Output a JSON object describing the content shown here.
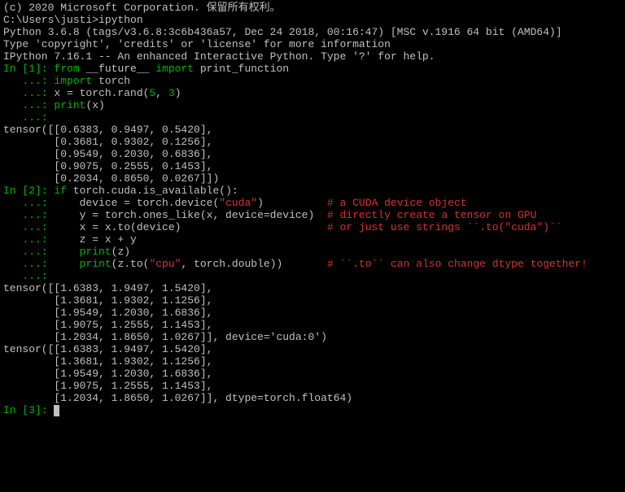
{
  "header": {
    "copyright": "(c) 2020 Microsoft Corporation. 保留所有权利。",
    "blank1": "",
    "prompt_cmd": "C:\\Users\\justi>ipython",
    "py_ver": "Python 3.6.8 (tags/v3.6.8:3c6b436a57, Dec 24 2018, 00:16:47) [MSC v.1916 64 bit (AMD64)]",
    "type_info": "Type 'copyright', 'credits' or 'license' for more information",
    "ipy_ver": "IPython 7.16.1 -- An enhanced Interactive Python. Type '?' for help.",
    "blank2": ""
  },
  "in1": {
    "p0": "In [1]: ",
    "p1": "   ...: ",
    "kw_from": "from",
    "mod_future": " __future__ ",
    "kw_import1": "import",
    "txt_print_function": " print_function",
    "kw_import2": "import",
    "mod_torch": " torch",
    "assign_x": "x = torch.rand(",
    "num5": "5",
    "comma1": ", ",
    "num3": "3",
    "paren_close": ")",
    "print_call": "print",
    "print_arg": "(x)"
  },
  "out1": {
    "l0": "tensor([[0.6383, 0.9497, 0.5420],",
    "l1": "        [0.3681, 0.9302, 0.1256],",
    "l2": "        [0.9549, 0.2030, 0.6836],",
    "l3": "        [0.9075, 0.2555, 0.1453],",
    "l4": "        [0.2034, 0.8650, 0.0267]])",
    "blank": ""
  },
  "in2": {
    "p0": "In [2]: ",
    "p1": "   ...: ",
    "kw_if": "if",
    "cond": " torch.cuda.is_available():",
    "dev_pre": "    device = torch.device(",
    "cuda_str": "\"cuda\"",
    "dev_post": ")          ",
    "cmt1": "# a CUDA device object",
    "y_line": "    y = torch.ones_like(x, device=device)  ",
    "cmt2": "# directly create a tensor on GPU",
    "xto_line": "    x = x.to(device)                       ",
    "cmt3": "# or just use strings ``.to(\"cuda\")``",
    "z_line": "    z = x + y",
    "indent4": "    ",
    "print1": "print",
    "print1_arg": "(z)",
    "print2": "print",
    "print2_pre": "(z.to(",
    "cpu_str": "\"cpu\"",
    "print2_post": ", torch.double))       ",
    "cmt4": "# ``.to`` can also change dtype together!"
  },
  "out2": {
    "l0": "tensor([[1.6383, 1.9497, 1.5420],",
    "l1": "        [1.3681, 1.9302, 1.1256],",
    "l2": "        [1.9549, 1.2030, 1.6836],",
    "l3": "        [1.9075, 1.2555, 1.1453],",
    "l4": "        [1.2034, 1.8650, 1.0267]], device='cuda:0')",
    "l5": "tensor([[1.6383, 1.9497, 1.5420],",
    "l6": "        [1.3681, 1.9302, 1.1256],",
    "l7": "        [1.9549, 1.2030, 1.6836],",
    "l8": "        [1.9075, 1.2555, 1.1453],",
    "l9": "        [1.2034, 1.8650, 1.0267]], dtype=torch.float64)",
    "blank": ""
  },
  "in3": {
    "p": "In [3]: "
  }
}
